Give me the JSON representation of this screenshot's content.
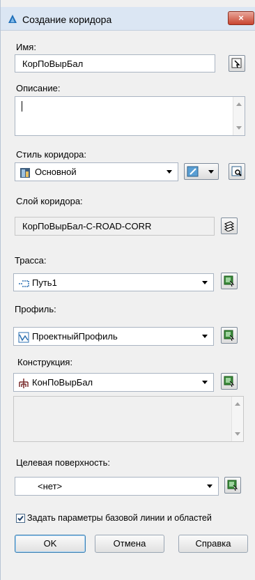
{
  "dialog": {
    "title": "Создание коридора",
    "close_label": "×"
  },
  "name": {
    "label": "Имя:",
    "value": "КорПоВырБал"
  },
  "description": {
    "label": "Описание:",
    "value": ""
  },
  "corridor_style": {
    "label": "Стиль коридора:",
    "value": "Основной"
  },
  "corridor_layer": {
    "label": "Слой коридора:",
    "value": "КорПоВырБал-C-ROAD-CORR"
  },
  "alignment": {
    "label": "Трасса:",
    "value": "Путь1"
  },
  "profile": {
    "label": "Профиль:",
    "value": "ПроектныйПрофиль"
  },
  "assembly": {
    "label": "Конструкция:",
    "value": "КонПоВырБал"
  },
  "target_surface": {
    "label": "Целевая поверхность:",
    "value": "<нет>"
  },
  "baseline_checkbox": {
    "label": "Задать параметры базовой линии и областей",
    "checked": true
  },
  "buttons": {
    "ok": "OK",
    "cancel": "Отмена",
    "help": "Справка"
  },
  "icons": {
    "app": "autocad-civil-icon",
    "style_edit": "edit-style-icon",
    "browse": "browse-icon",
    "layer": "layer-icon",
    "pick": "pick-from-drawing-icon"
  }
}
